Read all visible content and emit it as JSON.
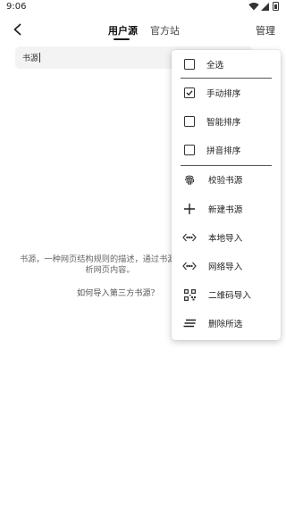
{
  "status_bar": {
    "time": "9:06"
  },
  "topbar": {
    "tabs": [
      {
        "label": "用户源",
        "selected": true
      },
      {
        "label": "官方站",
        "selected": false
      }
    ],
    "manage_label": "管理"
  },
  "search": {
    "value": "书源"
  },
  "empty_state": {
    "description": "书源，一种网页结构规则的描述，通过书源可以解析网页内容。",
    "import_link": "如何导入第三方书源？"
  },
  "menu": {
    "checks": [
      {
        "label": "全选",
        "checked": false
      },
      {
        "label": "手动排序",
        "checked": true
      },
      {
        "label": "智能排序",
        "checked": false
      },
      {
        "label": "拼音排序",
        "checked": false
      }
    ],
    "actions": [
      {
        "label": "校验书源",
        "icon": "fingerprint-icon"
      },
      {
        "label": "新建书源",
        "icon": "plus-icon"
      },
      {
        "label": "本地导入",
        "icon": "code-icon"
      },
      {
        "label": "网络导入",
        "icon": "code-icon"
      },
      {
        "label": "二维码导入",
        "icon": "qr-code-icon"
      },
      {
        "label": "删除所选",
        "icon": "delete-lines-icon"
      }
    ]
  },
  "colors": {
    "accent": "#1a1a1a",
    "background": "#ffffff",
    "search_bg": "#f3f3f3"
  }
}
